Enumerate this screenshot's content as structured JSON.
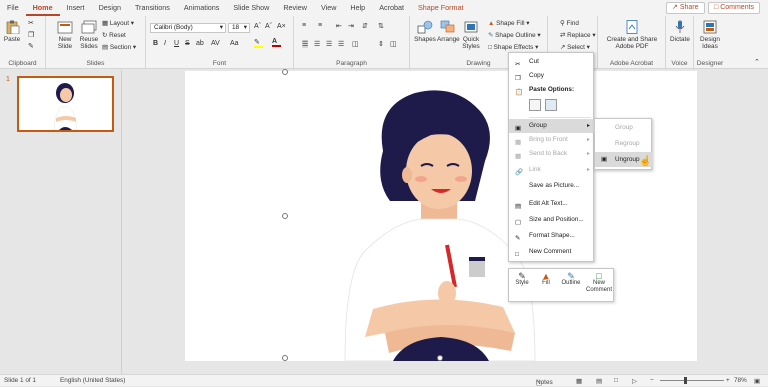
{
  "tabs": [
    "File",
    "Home",
    "Insert",
    "Design",
    "Transitions",
    "Animations",
    "Slide Show",
    "Review",
    "View",
    "Help",
    "Acrobat",
    "Shape Format"
  ],
  "active_tab": "Home",
  "share_label": "Share",
  "comments_label": "Comments",
  "ribbon": {
    "clipboard": {
      "paste": "Paste",
      "label": "Clipboard"
    },
    "slides": {
      "new": "New",
      "new2": "Slide",
      "reuse": "Reuse",
      "reuse2": "Slides",
      "layout": "Layout",
      "reset": "Reset",
      "section": "Section",
      "label": "Slides"
    },
    "font": {
      "name": "Calibri (Body)",
      "size": "18",
      "bold": "B",
      "italic": "I",
      "underline": "U",
      "strike": "S",
      "shadow": "ab",
      "spacing": "AV",
      "case": "Aa",
      "label": "Font"
    },
    "paragraph": {
      "label": "Paragraph"
    },
    "drawing": {
      "shapes": "Shapes",
      "arrange": "Arrange",
      "quick": "Quick",
      "quick2": "Styles",
      "fill": "Shape Fill",
      "outline": "Shape Outline",
      "effects": "Shape Effects",
      "label": "Drawing"
    },
    "editing": {
      "find": "Find",
      "replace": "Replace",
      "select": "Select"
    },
    "acrobat": {
      "btn1": "Create and Share",
      "btn2": "Adobe PDF",
      "label": "Adobe Acrobat"
    },
    "voice": {
      "btn": "Dictate",
      "label": "Voice"
    },
    "designer": {
      "btn1": "Design",
      "btn2": "Ideas",
      "label": "Designer"
    }
  },
  "slide_number": "1",
  "context_menu": {
    "cut": "Cut",
    "copy": "Copy",
    "paste_options": "Paste Options:",
    "group": "Group",
    "bring_front": "Bring to Front",
    "send_back": "Send to Back",
    "link": "Link",
    "save_picture": "Save as Picture...",
    "alt_text": "Edit Alt Text...",
    "size_position": "Size and Position...",
    "format_shape": "Format Shape...",
    "new_comment": "New Comment"
  },
  "submenu": {
    "group": "Group",
    "regroup": "Regroup",
    "ungroup": "Ungroup"
  },
  "mini_toolbar": {
    "style": "Style",
    "fill": "Fill",
    "outline": "Outline",
    "new": "New",
    "comment": "Comment"
  },
  "status": {
    "slide": "Slide 1 of 1",
    "lang": "English (United States)",
    "notes": "Notes",
    "zoom": "78%"
  },
  "colors": {
    "accent": "#b7472a",
    "hair": "#1e1b4b",
    "skin": "#f5c9a8",
    "shirt": "#ffffff"
  }
}
